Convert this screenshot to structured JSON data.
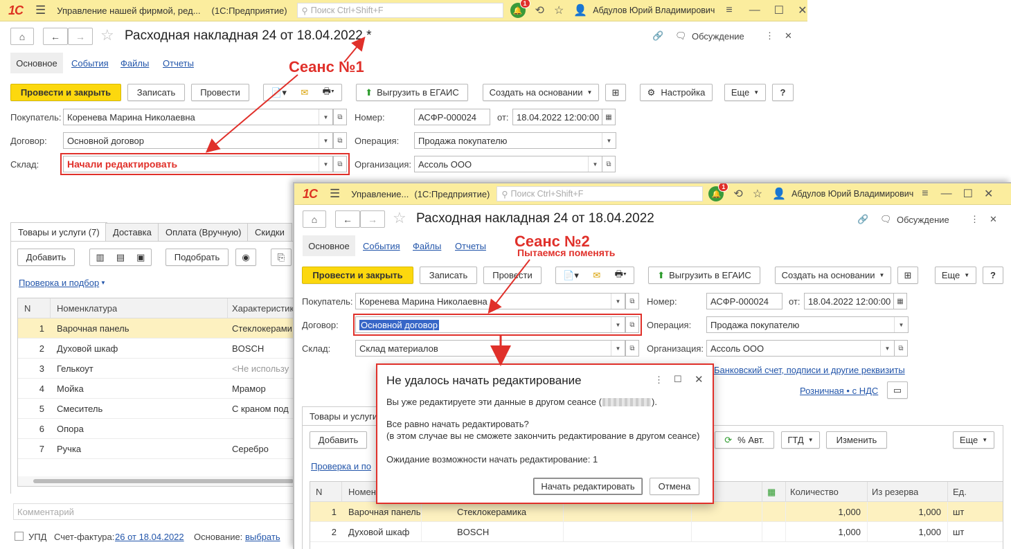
{
  "colors": {
    "accent": "#fcd80e",
    "title_bar": "#fbed9e",
    "annotation": "#e0302a",
    "link": "#2255aa"
  },
  "w1": {
    "app_logo": "1С",
    "app_title": "Управление нашей фирмой, ред...",
    "platform": "(1С:Предприятие)",
    "search_placeholder": "Поиск Ctrl+Shift+F",
    "notif_count": "1",
    "user": "Абдулов Юрий Владимирович",
    "doc_title": "Расходная накладная 24 от 18.04.2022 *",
    "discussion": "Обсуждение",
    "tabs": [
      "Основное",
      "События",
      "Файлы",
      "Отчеты"
    ],
    "toolbar": {
      "post_close": "Провести и закрыть",
      "save": "Записать",
      "post": "Провести",
      "egais": "Выгрузить в ЕГАИС",
      "create_based": "Создать на основании",
      "settings": "Настройка",
      "more": "Еще",
      "help": "?"
    },
    "fields": {
      "buyer_label": "Покупатель:",
      "buyer": "Коренева Марина Николаевна",
      "contract_label": "Договор:",
      "contract": "Основной договор",
      "warehouse_label": "Склад:",
      "warehouse": "Начали редактировать",
      "number_label": "Номер:",
      "number": "АСФР-000024",
      "date_label": "от:",
      "date": "18.04.2022 12:00:00",
      "operation_label": "Операция:",
      "operation": "Продажа покупателю",
      "org_label": "Организация:",
      "org": "Ассоль ООО"
    },
    "bottom_tabs": [
      "Товары и услуги (7)",
      "Доставка",
      "Оплата (Вручную)",
      "Скидки"
    ],
    "grid_toolbar": {
      "add": "Добавить",
      "pick": "Подобрать"
    },
    "check_link": "Проверка и подбор",
    "columns": [
      "N",
      "Номенклатура",
      "Характеристик"
    ],
    "rows": [
      [
        "1",
        "Варочная панель",
        "Стеклокерами"
      ],
      [
        "2",
        "Духовой шкаф",
        "BOSCH"
      ],
      [
        "3",
        "Гелькоут",
        "<Не использу"
      ],
      [
        "4",
        "Мойка",
        "Мрамор"
      ],
      [
        "5",
        "Смеситель",
        "С краном под"
      ],
      [
        "6",
        "Опора",
        ""
      ],
      [
        "7",
        "Ручка",
        "Серебро"
      ]
    ],
    "comment_placeholder": "Комментарий",
    "upd": "УПД",
    "invoice_label": "Счет-фактура:",
    "invoice_link": "26  от 18.04.2022",
    "basis_label": "Основание:",
    "basis_link": "выбрать",
    "annotation": "Сеанс №1"
  },
  "w2": {
    "app_logo": "1С",
    "app_title": "Управление...",
    "platform": "(1С:Предприятие)",
    "search_placeholder": "Поиск Ctrl+Shift+F",
    "notif_count": "1",
    "user": "Абдулов Юрий Владимирович",
    "doc_title": "Расходная накладная 24 от 18.04.2022",
    "discussion": "Обсуждение",
    "tabs": [
      "Основное",
      "События",
      "Файлы",
      "Отчеты"
    ],
    "toolbar": {
      "post_close": "Провести и закрыть",
      "save": "Записать",
      "post": "Провести",
      "egais": "Выгрузить в ЕГАИС",
      "create_based": "Создать на основании",
      "more": "Еще",
      "help": "?"
    },
    "fields": {
      "buyer_label": "Покупатель:",
      "buyer": "Коренева Марина Николаевна",
      "contract_label": "Договор:",
      "contract": "Основной договор",
      "warehouse_label": "Склад:",
      "warehouse": "Склад материалов",
      "number_label": "Номер:",
      "number": "АСФР-000024",
      "date_label": "от:",
      "date": "18.04.2022 12:00:00",
      "operation_label": "Операция:",
      "operation": "Продажа покупателю",
      "org_label": "Организация:",
      "org": "Ассоль ООО"
    },
    "bank_link": "Банковский счет, подписи и другие реквизиты",
    "price_link": "Розничная • с НДС",
    "bottom_tab": "Товары и услуги",
    "grid_toolbar": {
      "add": "Добавить",
      "auto_pct": "% Авт.",
      "gtd": "ГТД",
      "change": "Изменить",
      "more": "Еще"
    },
    "check_link": "Проверка и по",
    "columns": {
      "n": "N",
      "nom": "Номен",
      "qty": "Количество",
      "reserve": "Из резерва",
      "unit": "Ед."
    },
    "rows": [
      [
        "1",
        "Варочная панель",
        "Стеклокерамика",
        "1,000",
        "1,000",
        "шт"
      ],
      [
        "2",
        "Духовой шкаф",
        "BOSCH",
        "1,000",
        "1,000",
        "шт"
      ]
    ],
    "annotation": "Сеанс №2",
    "annotation_sub": "Пытаемся поменять"
  },
  "dialog": {
    "title": "Не удалось начать редактирование",
    "line1": "Вы уже редактируете эти данные в другом сеансе (",
    "line1_end": ").",
    "line2": "Все равно начать редактировать?",
    "line3": "(в этом случае вы не сможете закончить редактирование в другом сеансе)",
    "wait_label": "Ожидание возможности начать редактирование:",
    "wait_value": "1",
    "start_btn": "Начать редактировать",
    "cancel_btn": "Отмена"
  }
}
